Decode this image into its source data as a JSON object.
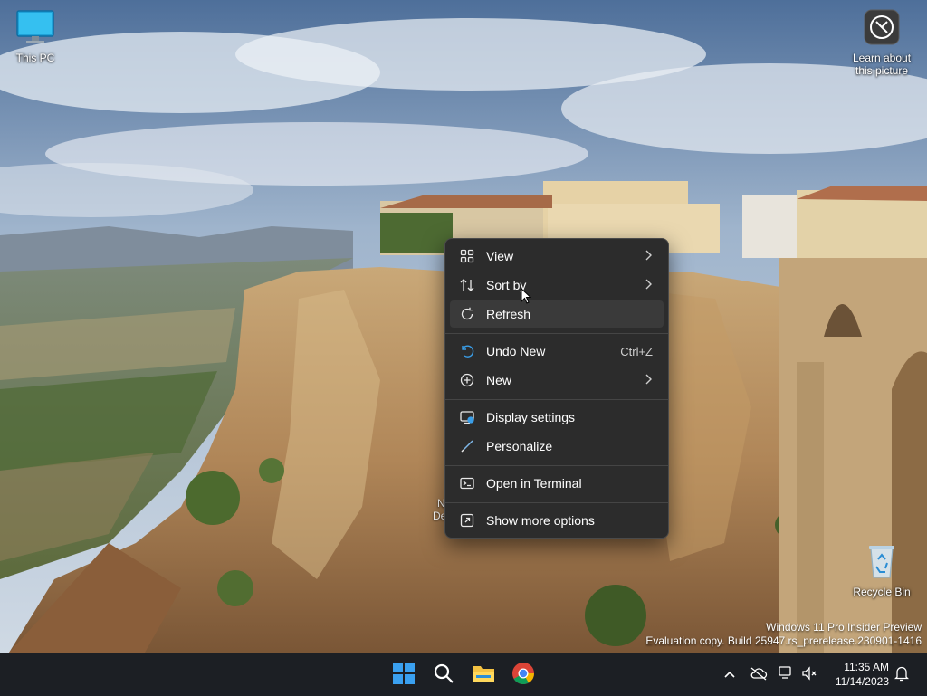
{
  "desktop": {
    "icons": [
      {
        "label": "This PC"
      },
      {
        "label": "Learn about this picture"
      },
      {
        "label": "Recycle Bin"
      }
    ],
    "watermark": {
      "line1": "Windows 11 Pro Insider Preview",
      "line2": "Evaluation copy. Build 25947.rs_prerelease.230901-1416"
    },
    "hidden_icon_fragment": {
      "line1": "N",
      "line2": "De"
    }
  },
  "context_menu": {
    "items": [
      {
        "label": "View",
        "icon": "grid-icon",
        "submenu": true
      },
      {
        "label": "Sort by",
        "icon": "sort-icon",
        "submenu": true
      },
      {
        "label": "Refresh",
        "icon": "refresh-icon",
        "highlighted": true
      },
      {
        "label": "Undo New",
        "icon": "undo-icon",
        "shortcut": "Ctrl+Z"
      },
      {
        "label": "New",
        "icon": "new-icon",
        "submenu": true
      },
      {
        "label": "Display settings",
        "icon": "display-settings-icon"
      },
      {
        "label": "Personalize",
        "icon": "brush-icon"
      },
      {
        "label": "Open in Terminal",
        "icon": "terminal-icon"
      },
      {
        "label": "Show more options",
        "icon": "more-options-icon"
      }
    ]
  },
  "taskbar": {
    "apps": [
      "start-icon",
      "search-icon",
      "file-explorer-icon",
      "chrome-icon"
    ],
    "tray": {
      "time": "11:35 AM",
      "date": "11/14/2023"
    }
  },
  "colors": {
    "menu_bg": "#2c2c2c",
    "menu_hover": "#3a3a3a",
    "taskbar_bg": "#1c1f24",
    "accent": "#3a9ee8"
  }
}
